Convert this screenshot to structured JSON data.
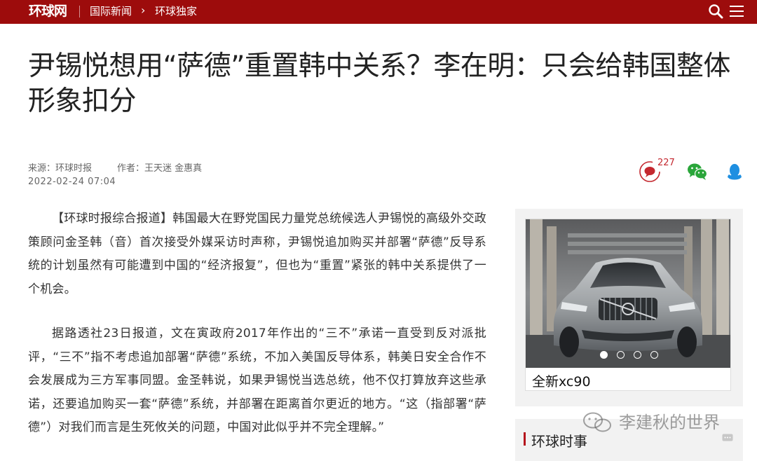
{
  "header": {
    "logo": "环球网",
    "breadcrumb_1": "国际新闻",
    "breadcrumb_arrow": "›",
    "breadcrumb_2": "环球独家",
    "bg_color": "#9d0c0c"
  },
  "article": {
    "title": "尹锡悦想用“萨德”重置韩中关系？李在明：只会给韩国整体形象扣分",
    "source": "来源：环球时报",
    "author": "作者：王天迷 金惠真",
    "date": "2022-02-24 07:04",
    "comment_count": "227",
    "paragraphs": [
      "【环球时报综合报道】韩国最大在野党国民力量党总统候选人尹锡悦的高级外交政策顾问金圣韩（音）首次接受外媒采访时声称，尹锡悦追加购买并部署“萨德”反导系统的计划虽然有可能遭到中国的“经济报复”，但也为“重置”紧张的韩中关系提供了一个机会。",
      "据路透社23日报道，文在寅政府2017年作出的“三不”承诺一直受到反对派批评，“三不”指不考虑追加部署“萨德”系统，不加入美国反导体系，韩美日安全合作不会发展成为三方军事同盟。金圣韩说，如果尹锡悦当选总统，他不仅打算放弃这些承诺，还要追加购买一套“萨德”系统，并部署在距离首尔更近的地方。“这（指部署“萨德”）对我们而言是生死攸关的问题，中国对此似乎并不完全理解。”"
    ]
  },
  "sidebar": {
    "ad_caption": "全新xc90",
    "carousel_total": 4,
    "carousel_active": 1,
    "section_title": "环球时事",
    "accent_color": "#b5141c"
  },
  "icons": {
    "search": "search-icon",
    "menu": "menu-icon",
    "comment": "comment-icon",
    "wechat": "wechat-icon",
    "qq": "qq-icon"
  },
  "watermark": {
    "text": "李建秋的世界"
  }
}
